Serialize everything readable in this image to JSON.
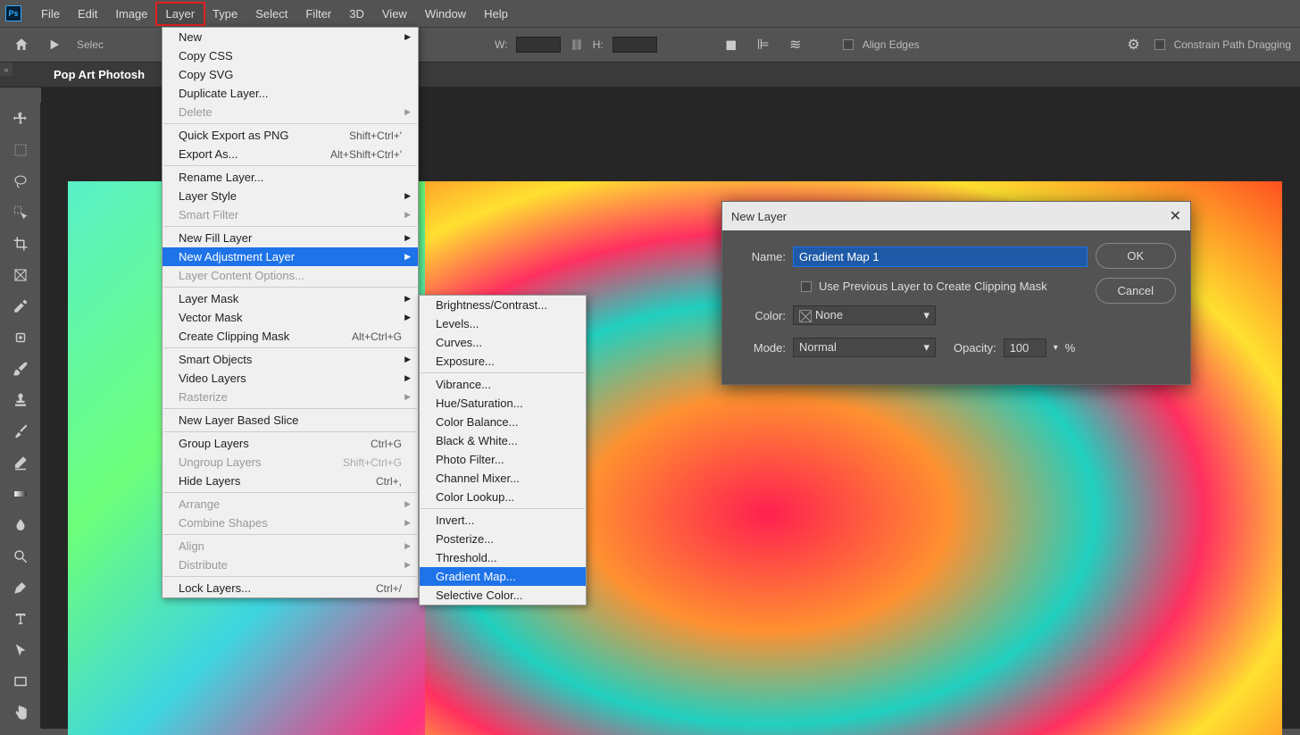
{
  "app": {
    "logo": "Ps"
  },
  "menubar": [
    "File",
    "Edit",
    "Image",
    "Layer",
    "Type",
    "Select",
    "Filter",
    "3D",
    "View",
    "Window",
    "Help"
  ],
  "menubar_active": "Layer",
  "optbar": {
    "select": "Selec",
    "w": "W:",
    "h": "H:",
    "align_edges": "Align Edges",
    "constrain": "Constrain Path Dragging"
  },
  "tab": {
    "title": "Pop Art Photosh"
  },
  "layer_menu": [
    {
      "label": "New",
      "sub": true
    },
    {
      "label": "Copy CSS"
    },
    {
      "label": "Copy SVG"
    },
    {
      "label": "Duplicate Layer..."
    },
    {
      "label": "Delete",
      "sub": true,
      "disabled": true
    },
    {
      "sep": true
    },
    {
      "label": "Quick Export as PNG",
      "short": "Shift+Ctrl+'"
    },
    {
      "label": "Export As...",
      "short": "Alt+Shift+Ctrl+'"
    },
    {
      "sep": true
    },
    {
      "label": "Rename Layer..."
    },
    {
      "label": "Layer Style",
      "sub": true
    },
    {
      "label": "Smart Filter",
      "sub": true,
      "disabled": true
    },
    {
      "sep": true
    },
    {
      "label": "New Fill Layer",
      "sub": true
    },
    {
      "label": "New Adjustment Layer",
      "sub": true,
      "hl": true
    },
    {
      "label": "Layer Content Options...",
      "disabled": true
    },
    {
      "sep": true
    },
    {
      "label": "Layer Mask",
      "sub": true
    },
    {
      "label": "Vector Mask",
      "sub": true
    },
    {
      "label": "Create Clipping Mask",
      "short": "Alt+Ctrl+G"
    },
    {
      "sep": true
    },
    {
      "label": "Smart Objects",
      "sub": true
    },
    {
      "label": "Video Layers",
      "sub": true
    },
    {
      "label": "Rasterize",
      "sub": true,
      "disabled": true
    },
    {
      "sep": true
    },
    {
      "label": "New Layer Based Slice"
    },
    {
      "sep": true
    },
    {
      "label": "Group Layers",
      "short": "Ctrl+G"
    },
    {
      "label": "Ungroup Layers",
      "short": "Shift+Ctrl+G",
      "disabled": true
    },
    {
      "label": "Hide Layers",
      "short": "Ctrl+,"
    },
    {
      "sep": true
    },
    {
      "label": "Arrange",
      "sub": true,
      "disabled": true
    },
    {
      "label": "Combine Shapes",
      "sub": true,
      "disabled": true
    },
    {
      "sep": true
    },
    {
      "label": "Align",
      "sub": true,
      "disabled": true
    },
    {
      "label": "Distribute",
      "sub": true,
      "disabled": true
    },
    {
      "sep": true
    },
    {
      "label": "Lock Layers...",
      "short": "Ctrl+/"
    }
  ],
  "adjust_menu": [
    {
      "label": "Brightness/Contrast..."
    },
    {
      "label": "Levels..."
    },
    {
      "label": "Curves..."
    },
    {
      "label": "Exposure..."
    },
    {
      "sep": true
    },
    {
      "label": "Vibrance..."
    },
    {
      "label": "Hue/Saturation..."
    },
    {
      "label": "Color Balance..."
    },
    {
      "label": "Black & White..."
    },
    {
      "label": "Photo Filter..."
    },
    {
      "label": "Channel Mixer..."
    },
    {
      "label": "Color Lookup..."
    },
    {
      "sep": true
    },
    {
      "label": "Invert..."
    },
    {
      "label": "Posterize..."
    },
    {
      "label": "Threshold..."
    },
    {
      "label": "Gradient Map...",
      "hl": true
    },
    {
      "label": "Selective Color..."
    }
  ],
  "dialog": {
    "title": "New Layer",
    "name_label": "Name:",
    "name_value": "Gradient Map 1",
    "clip_label": "Use Previous Layer to Create Clipping Mask",
    "color_label": "Color:",
    "color_value": "None",
    "mode_label": "Mode:",
    "mode_value": "Normal",
    "opacity_label": "Opacity:",
    "opacity_value": "100",
    "opacity_unit": "%",
    "ok": "OK",
    "cancel": "Cancel"
  }
}
